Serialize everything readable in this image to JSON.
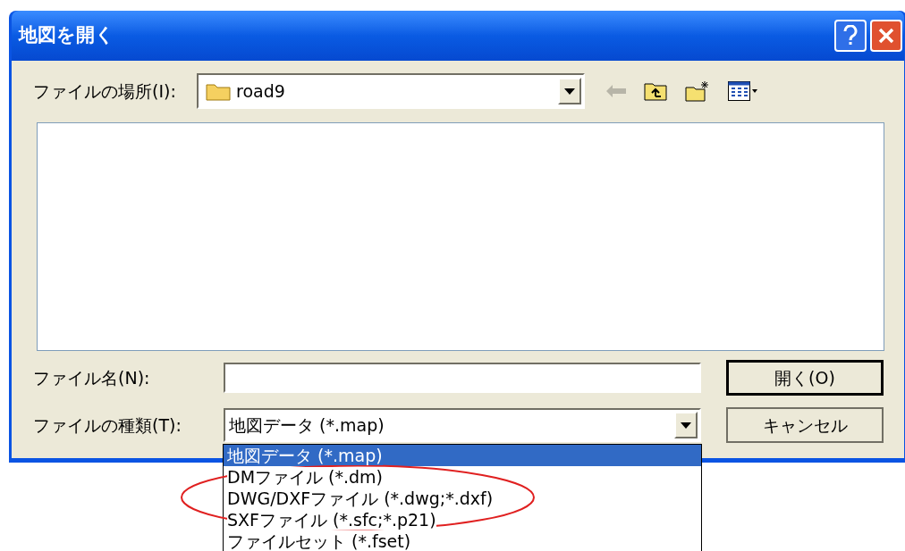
{
  "window": {
    "title": "地図を開く"
  },
  "location": {
    "label": "ファイルの場所(I):",
    "value": "road9"
  },
  "file_name": {
    "label": "ファイル名(N):"
  },
  "file_type": {
    "label": "ファイルの種類(T):",
    "value": "地図データ (*.map)",
    "expanded": true,
    "options": [
      {
        "label": "地図データ (*.map)",
        "selected": true
      },
      {
        "label": "DMファイル (*.dm)",
        "selected": false
      },
      {
        "label": "DWG/DXFファイル (*.dwg;*.dxf)",
        "selected": false
      },
      {
        "label": "SXFファイル (*.sfc;*.p21)",
        "selected": false
      },
      {
        "label": "ファイルセット (*.fset)",
        "selected": false
      }
    ]
  },
  "buttons": [
    {
      "label": "開く(O)",
      "kind": "default"
    },
    {
      "label": "キャンセル",
      "kind": "normal"
    }
  ]
}
